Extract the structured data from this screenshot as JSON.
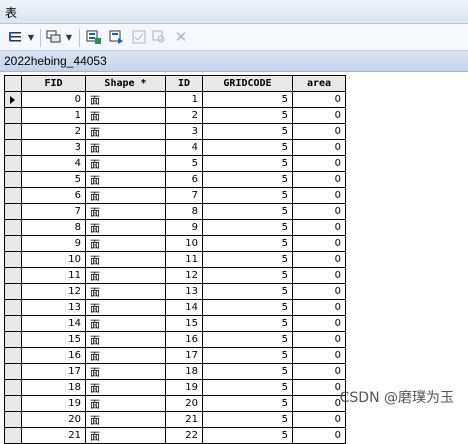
{
  "window": {
    "title": "表"
  },
  "toolbar": {
    "icons": [
      "table-options-icon",
      "dropdown-icon",
      "related-tables-icon",
      "dropdown-icon",
      "select-by-attributes-icon",
      "switch-selection-icon",
      "clear-selection-icon",
      "zoom-to-selected-icon",
      "delete-selected-icon"
    ]
  },
  "layer": {
    "name": "2022hebing_44053"
  },
  "table": {
    "columns": [
      "FID",
      "Shape *",
      "ID",
      "GRIDCODE",
      "area"
    ],
    "rows": [
      [
        "0",
        "面",
        "1",
        "5",
        "0"
      ],
      [
        "1",
        "面",
        "2",
        "5",
        "0"
      ],
      [
        "2",
        "面",
        "3",
        "5",
        "0"
      ],
      [
        "3",
        "面",
        "4",
        "5",
        "0"
      ],
      [
        "4",
        "面",
        "5",
        "5",
        "0"
      ],
      [
        "5",
        "面",
        "6",
        "5",
        "0"
      ],
      [
        "6",
        "面",
        "7",
        "5",
        "0"
      ],
      [
        "7",
        "面",
        "8",
        "5",
        "0"
      ],
      [
        "8",
        "面",
        "9",
        "5",
        "0"
      ],
      [
        "9",
        "面",
        "10",
        "5",
        "0"
      ],
      [
        "10",
        "面",
        "11",
        "5",
        "0"
      ],
      [
        "11",
        "面",
        "12",
        "5",
        "0"
      ],
      [
        "12",
        "面",
        "13",
        "5",
        "0"
      ],
      [
        "13",
        "面",
        "14",
        "5",
        "0"
      ],
      [
        "14",
        "面",
        "15",
        "5",
        "0"
      ],
      [
        "15",
        "面",
        "16",
        "5",
        "0"
      ],
      [
        "16",
        "面",
        "17",
        "5",
        "0"
      ],
      [
        "17",
        "面",
        "18",
        "5",
        "0"
      ],
      [
        "18",
        "面",
        "19",
        "5",
        "0"
      ],
      [
        "19",
        "面",
        "20",
        "5",
        "0"
      ],
      [
        "20",
        "面",
        "21",
        "5",
        "0"
      ],
      [
        "21",
        "面",
        "22",
        "5",
        "0"
      ]
    ]
  },
  "watermark": "CSDN @磨璞为玉"
}
